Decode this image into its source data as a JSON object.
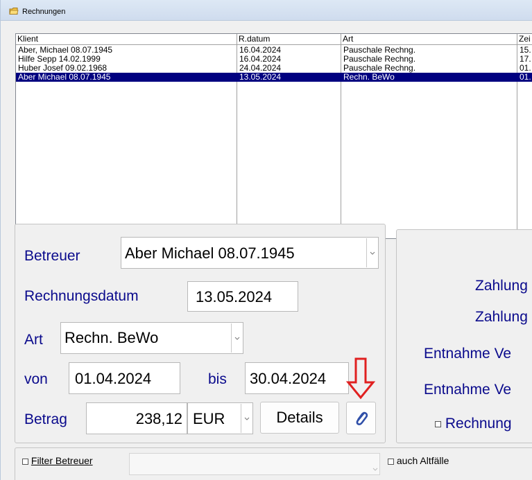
{
  "window": {
    "title": "Rechnungen"
  },
  "list": {
    "columns": [
      "Klient",
      "R.datum",
      "Art",
      "Zei"
    ],
    "rows": [
      {
        "klient": "Aber, Michael 08.07.1945",
        "rdatum": "16.04.2024",
        "art": "Pauschale Rechng.",
        "zeit": "15.",
        "selected": false
      },
      {
        "klient": "Hilfe Sepp 14.02.1999",
        "rdatum": "16.04.2024",
        "art": "Pauschale Rechng.",
        "zeit": "17.",
        "selected": false
      },
      {
        "klient": "Huber Josef 09.02.1968",
        "rdatum": "24.04.2024",
        "art": "Pauschale Rechng.",
        "zeit": "01.",
        "selected": false
      },
      {
        "klient": "Aber Michael 08.07.1945",
        "rdatum": "13.05.2024",
        "art": "Rechn. BeWo",
        "zeit": "01.",
        "selected": true
      }
    ]
  },
  "form": {
    "betreuer_label": "Betreuer",
    "betreuer_value": "Aber Michael 08.07.1945",
    "rechnungsdatum_label": "Rechnungsdatum",
    "rechnungsdatum_value": "13.05.2024",
    "art_label": "Art",
    "art_value": "Rechn. BeWo",
    "von_label": "von",
    "von_value": "01.04.2024",
    "bis_label": "bis",
    "bis_value": "30.04.2024",
    "betrag_label": "Betrag",
    "betrag_value": "238,12",
    "currency_value": "EUR",
    "details_button": "Details",
    "attach_icon": "paperclip-icon",
    "arrow_color": "#e02020"
  },
  "right_panel": {
    "labels": [
      "Zahlung",
      "Zahlung",
      "Entnahme Ve",
      "Entnahme Ve"
    ],
    "checkbox_label": "Rechnung"
  },
  "filter": {
    "filter_label": "Filter Betreuer",
    "filter_value": "",
    "altfaelle_label": "auch Altfälle"
  },
  "colors": {
    "label_blue": "#0a0a8c",
    "selection": "#000080"
  }
}
